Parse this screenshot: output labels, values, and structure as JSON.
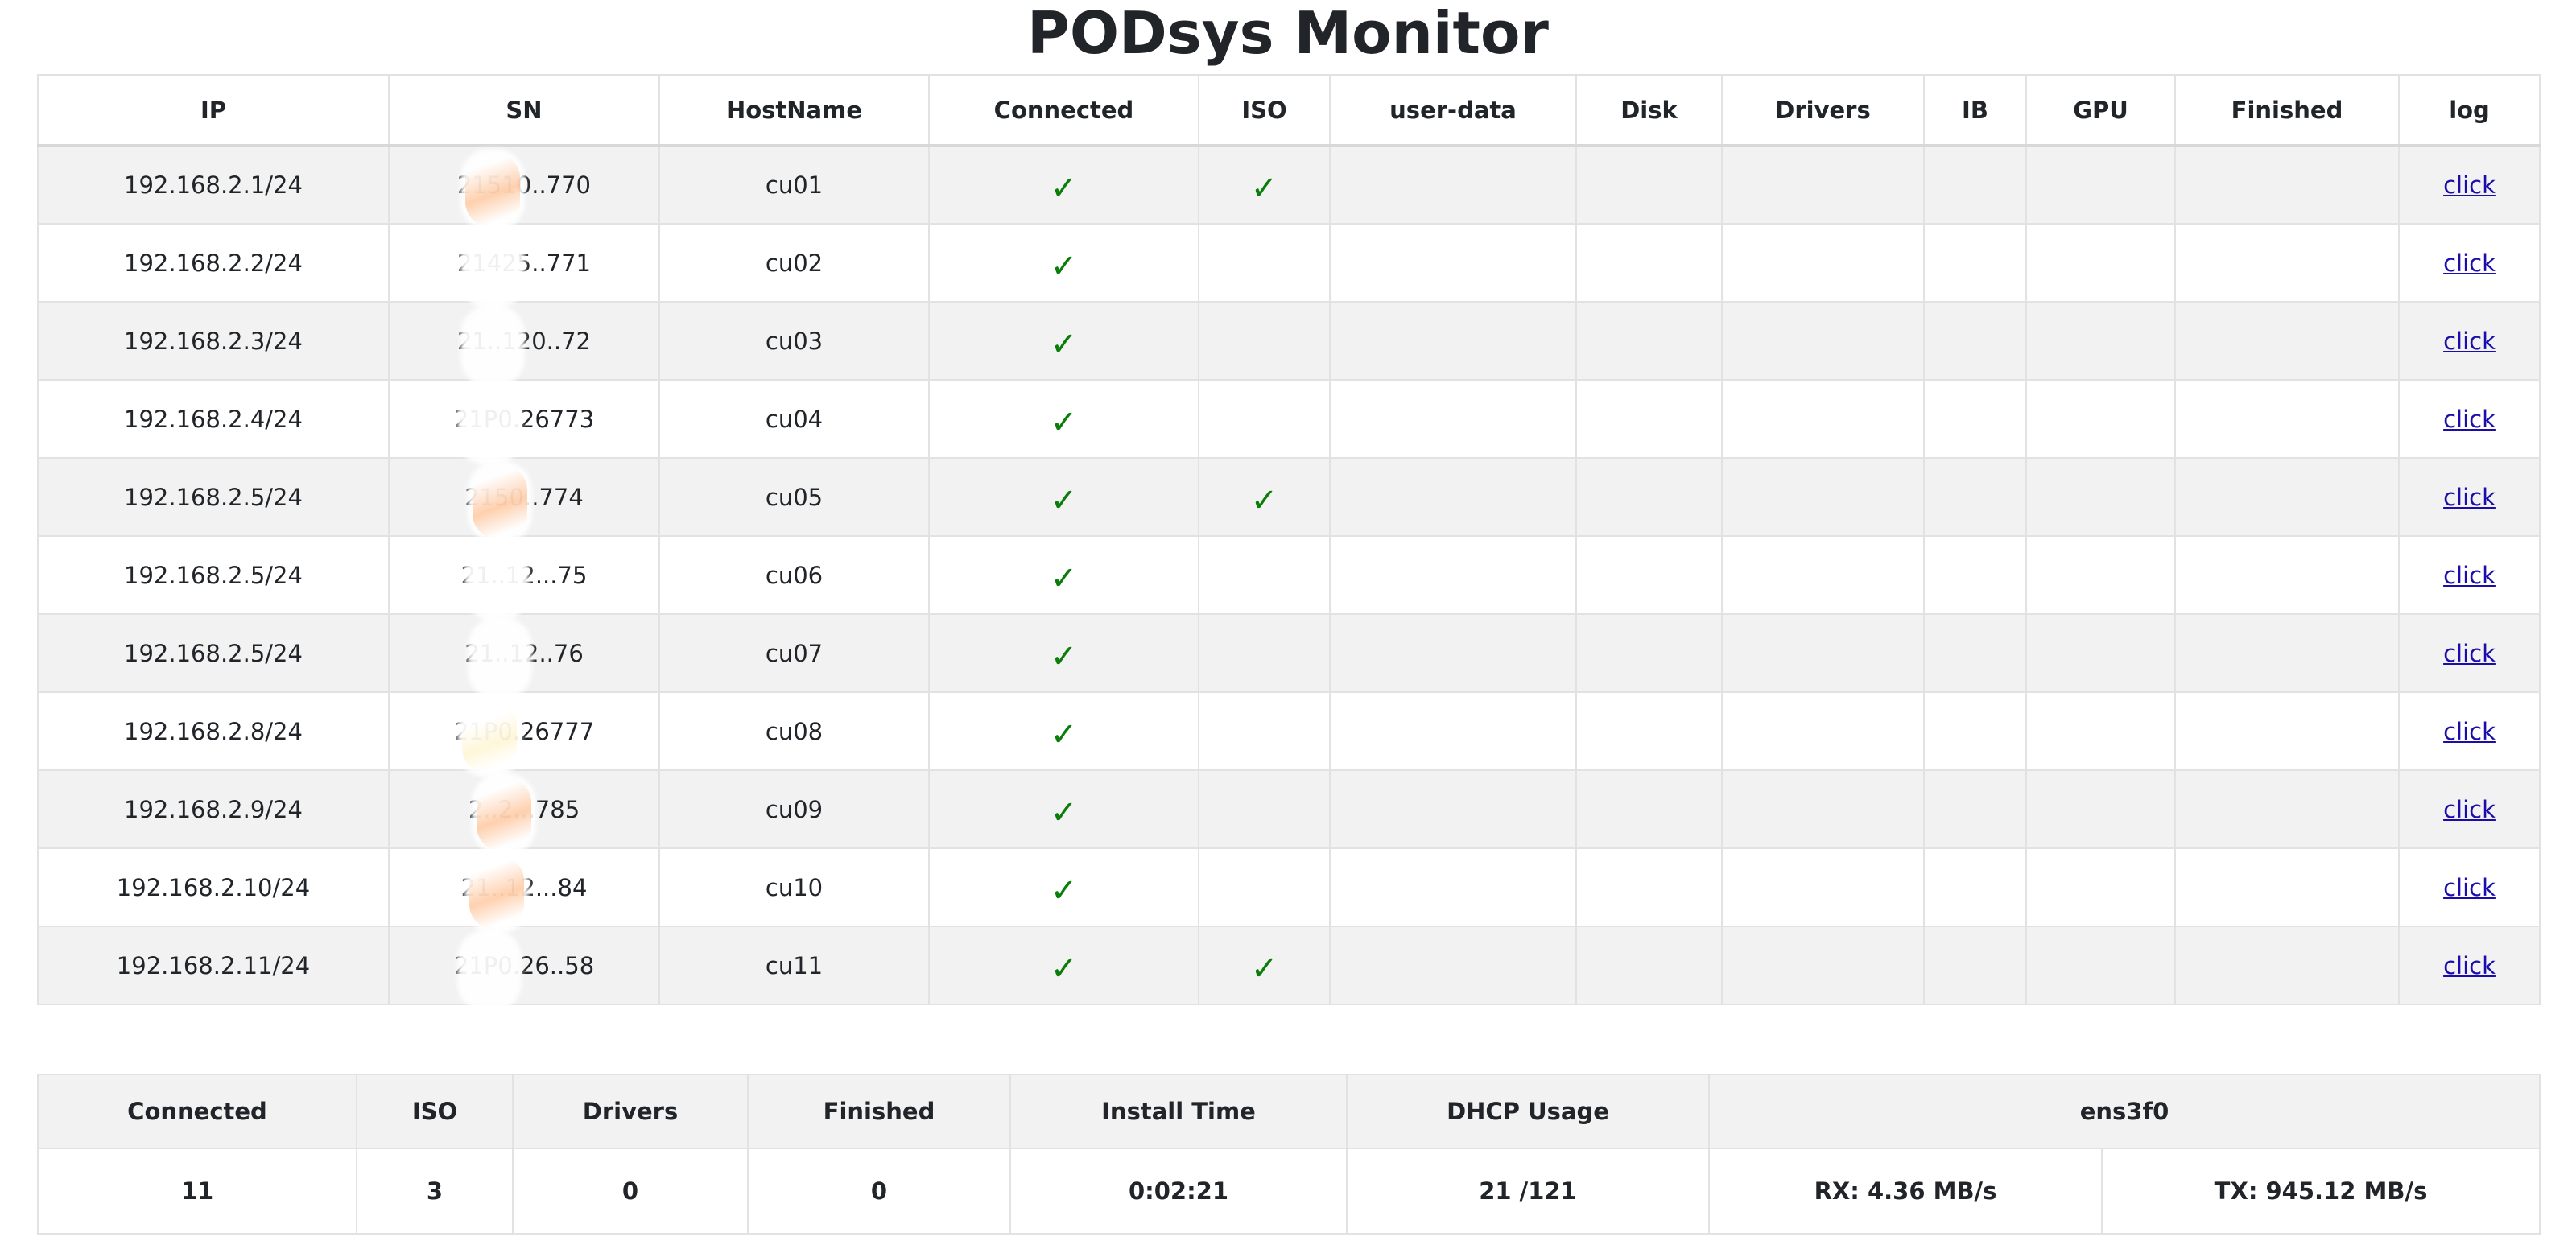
{
  "title": "PODsys Monitor",
  "colors": {
    "check": "#0a7d0a",
    "link": "#1a0dab",
    "row_stripe": "#f2f2f2",
    "border": "#e2e2e2"
  },
  "check_glyph": "✓",
  "hosts_table": {
    "headers": [
      "IP",
      "SN",
      "HostName",
      "Connected",
      "ISO",
      "user-data",
      "Disk",
      "Drivers",
      "IB",
      "GPU",
      "Finished",
      "log"
    ],
    "rows": [
      {
        "ip": "192.168.2.1/24",
        "sn": "21510..770",
        "sn_tint": "orange",
        "hostname": "cu01",
        "connected": "✓",
        "iso": "✓",
        "user_data": "",
        "disk": "",
        "drivers": "",
        "ib": "",
        "gpu": "",
        "finished": "",
        "log": "click"
      },
      {
        "ip": "192.168.2.2/24",
        "sn": "21425..771",
        "sn_tint": "none",
        "hostname": "cu02",
        "connected": "✓",
        "iso": "",
        "user_data": "",
        "disk": "",
        "drivers": "",
        "ib": "",
        "gpu": "",
        "finished": "",
        "log": "click"
      },
      {
        "ip": "192.168.2.3/24",
        "sn": "21..120..72",
        "sn_tint": "none",
        "hostname": "cu03",
        "connected": "✓",
        "iso": "",
        "user_data": "",
        "disk": "",
        "drivers": "",
        "ib": "",
        "gpu": "",
        "finished": "",
        "log": "click"
      },
      {
        "ip": "192.168.2.4/24",
        "sn": "21P0.26773",
        "sn_tint": "none",
        "hostname": "cu04",
        "connected": "✓",
        "iso": "",
        "user_data": "",
        "disk": "",
        "drivers": "",
        "ib": "",
        "gpu": "",
        "finished": "",
        "log": "click"
      },
      {
        "ip": "192.168.2.5/24",
        "sn": "2150..774",
        "sn_tint": "orange",
        "hostname": "cu05",
        "connected": "✓",
        "iso": "✓",
        "user_data": "",
        "disk": "",
        "drivers": "",
        "ib": "",
        "gpu": "",
        "finished": "",
        "log": "click"
      },
      {
        "ip": "192.168.2.5/24",
        "sn": "21..12...75",
        "sn_tint": "none",
        "hostname": "cu06",
        "connected": "✓",
        "iso": "",
        "user_data": "",
        "disk": "",
        "drivers": "",
        "ib": "",
        "gpu": "",
        "finished": "",
        "log": "click"
      },
      {
        "ip": "192.168.2.5/24",
        "sn": "21..12..76",
        "sn_tint": "none",
        "hostname": "cu07",
        "connected": "✓",
        "iso": "",
        "user_data": "",
        "disk": "",
        "drivers": "",
        "ib": "",
        "gpu": "",
        "finished": "",
        "log": "click"
      },
      {
        "ip": "192.168.2.8/24",
        "sn": "21P0.26777",
        "sn_tint": "yellow",
        "hostname": "cu08",
        "connected": "✓",
        "iso": "",
        "user_data": "",
        "disk": "",
        "drivers": "",
        "ib": "",
        "gpu": "",
        "finished": "",
        "log": "click"
      },
      {
        "ip": "192.168.2.9/24",
        "sn": "2..2...785",
        "sn_tint": "orange",
        "hostname": "cu09",
        "connected": "✓",
        "iso": "",
        "user_data": "",
        "disk": "",
        "drivers": "",
        "ib": "",
        "gpu": "",
        "finished": "",
        "log": "click"
      },
      {
        "ip": "192.168.2.10/24",
        "sn": "21..12...84",
        "sn_tint": "orange",
        "hostname": "cu10",
        "connected": "✓",
        "iso": "",
        "user_data": "",
        "disk": "",
        "drivers": "",
        "ib": "",
        "gpu": "",
        "finished": "",
        "log": "click"
      },
      {
        "ip": "192.168.2.11/24",
        "sn": "21P0.26..58",
        "sn_tint": "none",
        "hostname": "cu11",
        "connected": "✓",
        "iso": "✓",
        "user_data": "",
        "disk": "",
        "drivers": "",
        "ib": "",
        "gpu": "",
        "finished": "",
        "log": "click"
      }
    ]
  },
  "summary_table": {
    "headers": [
      "Connected",
      "ISO",
      "Drivers",
      "Finished",
      "Install Time",
      "DHCP Usage",
      "ens3f0"
    ],
    "values": {
      "connected": "11",
      "iso": "3",
      "drivers": "0",
      "finished": "0",
      "install_time": "0:02:21",
      "dhcp_usage": "21 /121",
      "rx": "RX: 4.36 MB/s",
      "tx": "TX: 945.12 MB/s"
    }
  }
}
